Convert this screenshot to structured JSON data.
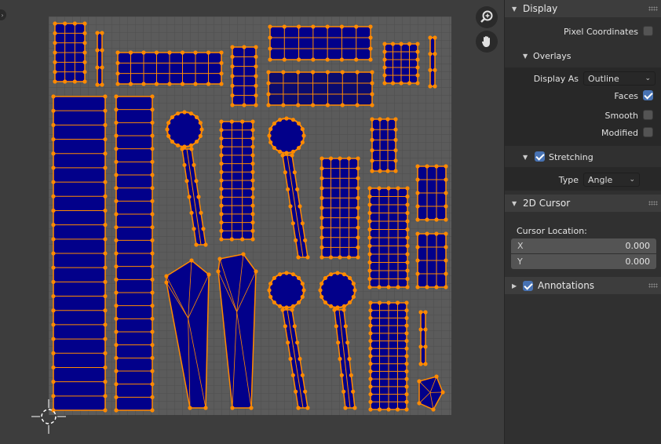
{
  "viewport": {
    "tools": [
      {
        "name": "zoom",
        "icon": "zoom-in-icon"
      },
      {
        "name": "pan",
        "icon": "hand-icon"
      }
    ],
    "colors": {
      "background": "#3d3d3d",
      "grid_bg": "#5b5b5b",
      "grid_line": "#4d4d4d",
      "face": "#02008a",
      "edge": "#ff8a00",
      "selected_face": "#0b0b6e",
      "cursor": "#ffffff"
    }
  },
  "sidebar": {
    "display_panel": {
      "title": "Display",
      "pixel_coordinates_label": "Pixel Coordinates",
      "pixel_coordinates_checked": false,
      "overlays": {
        "title": "Overlays",
        "display_as_label": "Display As",
        "display_as_value": "Outline",
        "faces_label": "Faces",
        "faces_checked": true,
        "smooth_label": "Smooth",
        "smooth_checked": false,
        "modified_label": "Modified",
        "modified_checked": false
      },
      "stretching": {
        "title": "Stretching",
        "checked": true,
        "type_label": "Type",
        "type_value": "Angle"
      }
    },
    "cursor_panel": {
      "title": "2D Cursor",
      "location_label": "Cursor Location:",
      "x_label": "X",
      "x_value": "0.000",
      "y_label": "Y",
      "y_value": "0.000"
    },
    "annotations_panel": {
      "title": "Annotations",
      "checked": true
    }
  }
}
